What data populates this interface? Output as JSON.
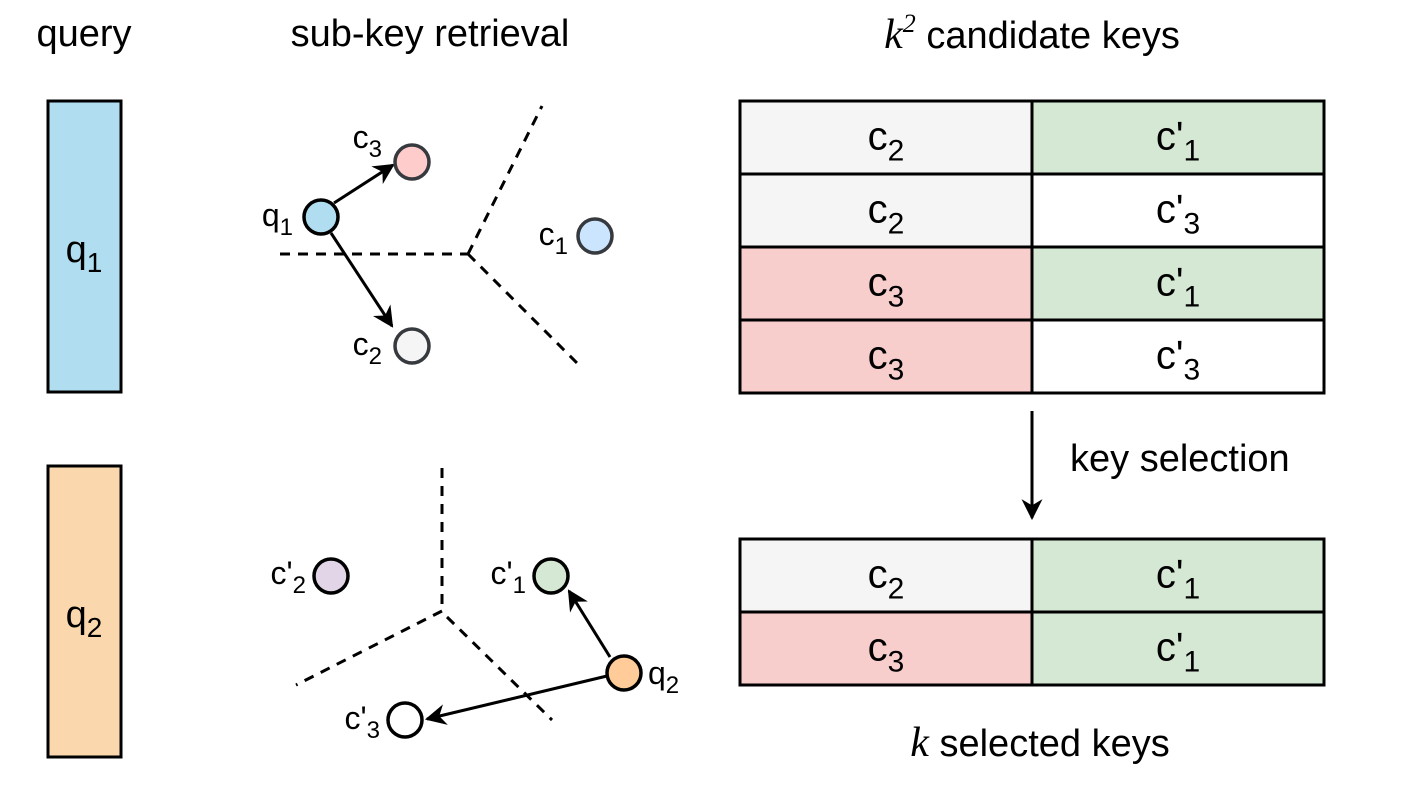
{
  "headers": {
    "query": "query",
    "subkey_retrieval": "sub-key retrieval",
    "candidate": {
      "math": "k",
      "sup": "2",
      "text": " candidate keys"
    },
    "selected": {
      "math": "k",
      "text": " selected keys"
    }
  },
  "queries": [
    {
      "base": "q",
      "sub": "1",
      "color": "#b1ddf0"
    },
    {
      "base": "q",
      "sub": "2",
      "color": "#fad7ac"
    }
  ],
  "retrieval_top": {
    "query_point": {
      "base": "q",
      "sub": "1",
      "color": "#b1ddf0"
    },
    "points": [
      {
        "id": "c3",
        "base": "c",
        "prime": "",
        "sub": "3",
        "color": "#ffcccc",
        "selected": true
      },
      {
        "id": "c1",
        "base": "c",
        "prime": "",
        "sub": "1",
        "color": "#cce5ff",
        "selected": false
      },
      {
        "id": "c2",
        "base": "c",
        "prime": "",
        "sub": "2",
        "color": "#f5f5f5",
        "selected": true
      }
    ]
  },
  "retrieval_bottom": {
    "query_point": {
      "base": "q",
      "sub": "2",
      "color": "#ffcc99"
    },
    "points": [
      {
        "id": "cp2",
        "base": "c",
        "prime": "'",
        "sub": "2",
        "color": "#e1d5e7",
        "selected": false
      },
      {
        "id": "cp1",
        "base": "c",
        "prime": "'",
        "sub": "1",
        "color": "#d5e8d4",
        "selected": true
      },
      {
        "id": "cp3",
        "base": "c",
        "prime": "'",
        "sub": "3",
        "color": "#ffffff",
        "selected": true
      }
    ]
  },
  "candidate_keys": [
    [
      {
        "base": "c",
        "prime": "",
        "sub": "2",
        "color": "#f5f5f5"
      },
      {
        "base": "c",
        "prime": "'",
        "sub": "1",
        "color": "#d5e8d4"
      }
    ],
    [
      {
        "base": "c",
        "prime": "",
        "sub": "2",
        "color": "#f5f5f5"
      },
      {
        "base": "c",
        "prime": "'",
        "sub": "3",
        "color": "#ffffff"
      }
    ],
    [
      {
        "base": "c",
        "prime": "",
        "sub": "3",
        "color": "#f8cecc"
      },
      {
        "base": "c",
        "prime": "'",
        "sub": "1",
        "color": "#d5e8d4"
      }
    ],
    [
      {
        "base": "c",
        "prime": "",
        "sub": "3",
        "color": "#f8cecc"
      },
      {
        "base": "c",
        "prime": "'",
        "sub": "3",
        "color": "#ffffff"
      }
    ]
  ],
  "selection_label": "key selection",
  "selected_keys": [
    [
      {
        "base": "c",
        "prime": "",
        "sub": "2",
        "color": "#f5f5f5"
      },
      {
        "base": "c",
        "prime": "'",
        "sub": "1",
        "color": "#d5e8d4"
      }
    ],
    [
      {
        "base": "c",
        "prime": "",
        "sub": "3",
        "color": "#f8cecc"
      },
      {
        "base": "c",
        "prime": "'",
        "sub": "1",
        "color": "#d5e8d4"
      }
    ]
  ]
}
